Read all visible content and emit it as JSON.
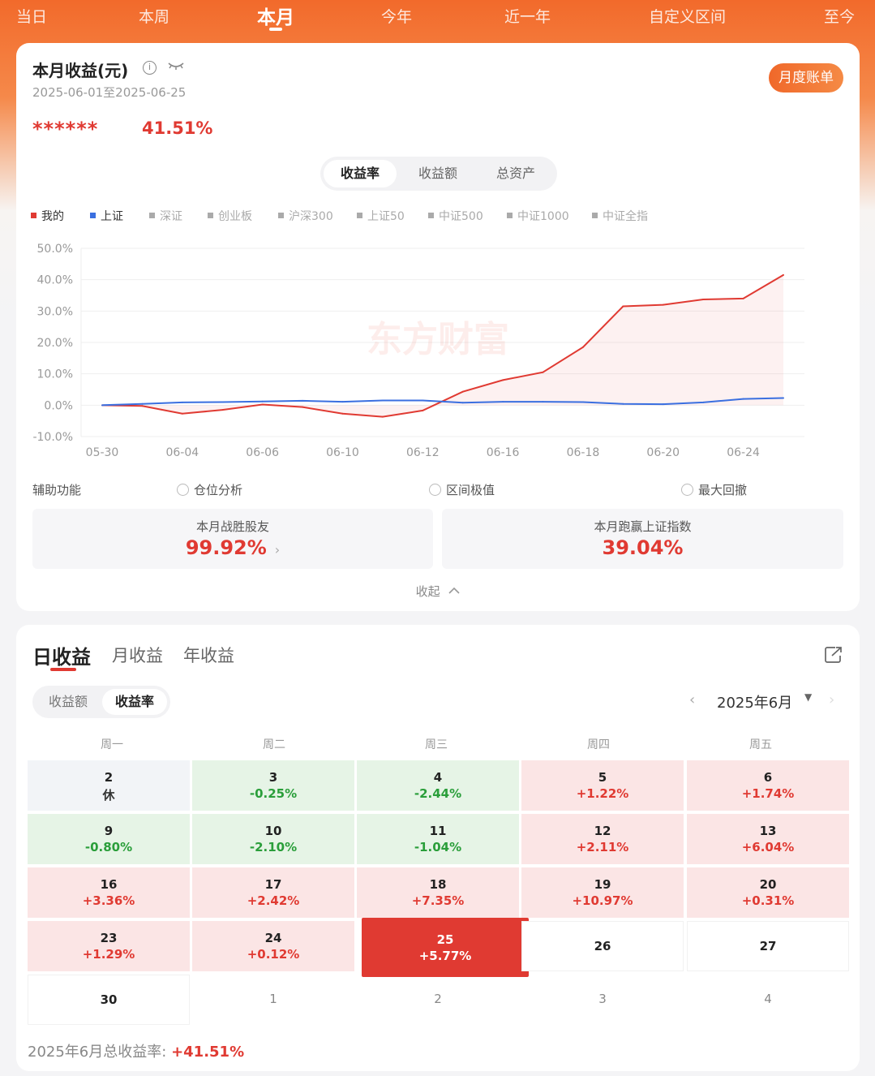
{
  "top_tabs": [
    {
      "label": "当日",
      "active": false
    },
    {
      "label": "本周",
      "active": false
    },
    {
      "label": "本月",
      "active": true
    },
    {
      "label": "今年",
      "active": false
    },
    {
      "label": "近一年",
      "active": false
    },
    {
      "label": "自定义区间",
      "active": false
    },
    {
      "label": "至今",
      "active": false
    }
  ],
  "summary": {
    "title": "本月收益(元)",
    "date_range": "2025-06-01至2025-06-25",
    "monthly_bill_button": "月度账单",
    "masked_amount": "******",
    "return_pct": "41.51%"
  },
  "chart_tabs": [
    {
      "label": "收益率",
      "active": true
    },
    {
      "label": "收益额",
      "active": false
    },
    {
      "label": "总资产",
      "active": false
    }
  ],
  "legend": [
    {
      "label": "我的",
      "color": "#e03a32",
      "active": true
    },
    {
      "label": "上证",
      "color": "#3a6fe0",
      "active": true
    },
    {
      "label": "深证",
      "color": "#aaaaaa",
      "active": false
    },
    {
      "label": "创业板",
      "color": "#aaaaaa",
      "active": false
    },
    {
      "label": "沪深300",
      "color": "#aaaaaa",
      "active": false
    },
    {
      "label": "上证50",
      "color": "#aaaaaa",
      "active": false
    },
    {
      "label": "中证500",
      "color": "#aaaaaa",
      "active": false
    },
    {
      "label": "中证1000",
      "color": "#aaaaaa",
      "active": false
    },
    {
      "label": "中证全指",
      "color": "#aaaaaa",
      "active": false
    }
  ],
  "chart_data": {
    "type": "line",
    "watermark": "东方财富",
    "ylim": [
      -10,
      50
    ],
    "y_ticks": [
      "50.0%",
      "40.0%",
      "30.0%",
      "20.0%",
      "10.0%",
      "0.0%",
      "-10.0%"
    ],
    "x_ticks": [
      "05-30",
      "06-04",
      "06-06",
      "06-10",
      "06-12",
      "06-16",
      "06-18",
      "06-20",
      "06-24"
    ],
    "x": [
      "05-30",
      "06-03",
      "06-04",
      "06-05",
      "06-06",
      "06-09",
      "06-10",
      "06-11",
      "06-12",
      "06-13",
      "06-16",
      "06-17",
      "06-18",
      "06-19",
      "06-20",
      "06-23",
      "06-24",
      "06-25"
    ],
    "series": [
      {
        "name": "我的",
        "color": "#e03a32",
        "area": true,
        "values": [
          0.0,
          -0.25,
          -2.7,
          -1.5,
          0.2,
          -0.6,
          -2.7,
          -3.7,
          -1.7,
          4.3,
          8.0,
          10.5,
          18.5,
          31.5,
          32.0,
          33.7,
          34.0,
          41.5
        ]
      },
      {
        "name": "上证",
        "color": "#3a6fe0",
        "area": false,
        "values": [
          0.0,
          0.4,
          0.9,
          1.0,
          1.2,
          1.4,
          1.1,
          1.5,
          1.5,
          0.8,
          1.1,
          1.1,
          1.0,
          0.4,
          0.3,
          0.9,
          2.0,
          2.3
        ]
      }
    ]
  },
  "aux": {
    "label": "辅助功能",
    "options": [
      "仓位分析",
      "区间极值",
      "最大回撤"
    ]
  },
  "stats": [
    {
      "label": "本月战胜股友",
      "value": "99.92%",
      "has_arrow": true
    },
    {
      "label": "本月跑赢上证指数",
      "value": "39.04%",
      "has_arrow": false
    }
  ],
  "collapse_label": "收起",
  "calendar": {
    "tabs": [
      {
        "label": "日收益",
        "active": true
      },
      {
        "label": "月收益",
        "active": false
      },
      {
        "label": "年收益",
        "active": false
      }
    ],
    "mode_tabs": [
      {
        "label": "收益额",
        "active": false
      },
      {
        "label": "收益率",
        "active": true
      }
    ],
    "month_label": "2025年6月",
    "weekdays": [
      "周一",
      "周二",
      "周三",
      "周四",
      "周五"
    ],
    "rows": [
      [
        {
          "day": "2",
          "value": "休",
          "style": "grey"
        },
        {
          "day": "3",
          "value": "-0.25%",
          "style": "green"
        },
        {
          "day": "4",
          "value": "-2.44%",
          "style": "green"
        },
        {
          "day": "5",
          "value": "+1.22%",
          "style": "red"
        },
        {
          "day": "6",
          "value": "+1.74%",
          "style": "red"
        }
      ],
      [
        {
          "day": "9",
          "value": "-0.80%",
          "style": "green"
        },
        {
          "day": "10",
          "value": "-2.10%",
          "style": "green"
        },
        {
          "day": "11",
          "value": "-1.04%",
          "style": "green"
        },
        {
          "day": "12",
          "value": "+2.11%",
          "style": "red"
        },
        {
          "day": "13",
          "value": "+6.04%",
          "style": "red"
        }
      ],
      [
        {
          "day": "16",
          "value": "+3.36%",
          "style": "red"
        },
        {
          "day": "17",
          "value": "+2.42%",
          "style": "red"
        },
        {
          "day": "18",
          "value": "+7.35%",
          "style": "red"
        },
        {
          "day": "19",
          "value": "+10.97%",
          "style": "red"
        },
        {
          "day": "20",
          "value": "+0.31%",
          "style": "red"
        }
      ],
      [
        {
          "day": "23",
          "value": "+1.29%",
          "style": "red"
        },
        {
          "day": "24",
          "value": "+0.12%",
          "style": "red"
        },
        {
          "day": "25",
          "value": "+5.77%",
          "style": "hot"
        },
        {
          "day": "26",
          "value": "",
          "style": "empty"
        },
        {
          "day": "27",
          "value": "",
          "style": "empty"
        }
      ],
      [
        {
          "day": "30",
          "value": "",
          "style": "empty"
        },
        {
          "day": "1",
          "value": "",
          "style": "next"
        },
        {
          "day": "2",
          "value": "",
          "style": "next"
        },
        {
          "day": "3",
          "value": "",
          "style": "next"
        },
        {
          "day": "4",
          "value": "",
          "style": "next"
        }
      ]
    ],
    "total_label": "2025年6月总收益率:",
    "total_value": "+41.51%"
  }
}
